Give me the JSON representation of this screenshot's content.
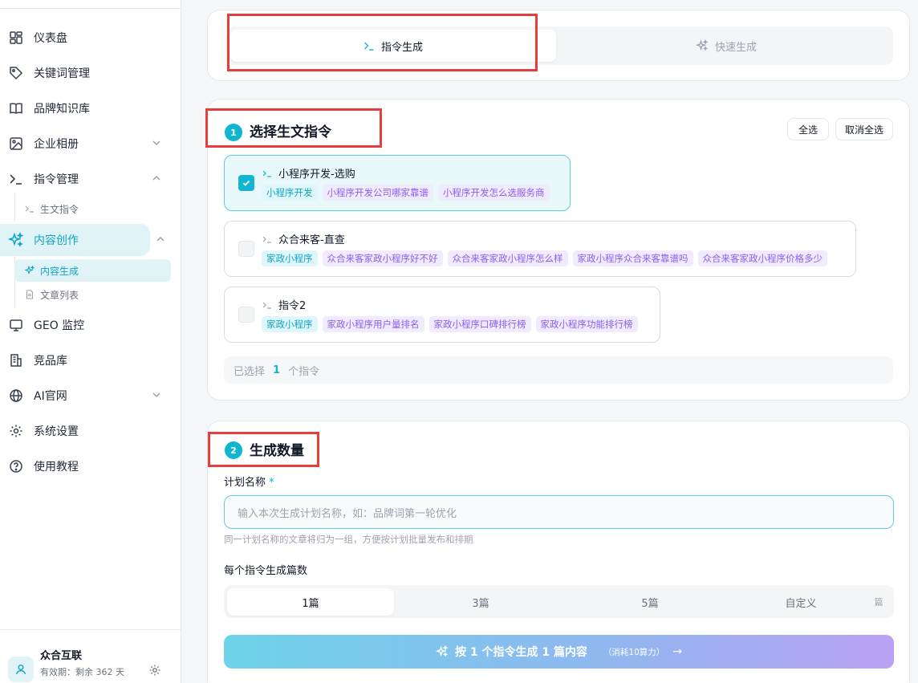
{
  "sidebar": {
    "items": [
      {
        "label": "仪表盘",
        "icon": "dashboard-icon"
      },
      {
        "label": "关键词管理",
        "icon": "tag-icon"
      },
      {
        "label": "品牌知识库",
        "icon": "book-icon"
      },
      {
        "label": "企业相册",
        "icon": "image-icon"
      },
      {
        "label": "指令管理",
        "icon": "terminal-icon"
      },
      {
        "label": "内容创作",
        "icon": "sparkles-icon"
      },
      {
        "label": "GEO 监控",
        "icon": "monitor-icon"
      },
      {
        "label": "竞品库",
        "icon": "building-icon"
      },
      {
        "label": "AI官网",
        "icon": "globe-icon"
      },
      {
        "label": "系统设置",
        "icon": "gear-icon"
      },
      {
        "label": "使用教程",
        "icon": "help-icon"
      }
    ],
    "subitems": {
      "command": {
        "label": "生文指令"
      },
      "content_generate": {
        "label": "内容生成"
      },
      "article_list": {
        "label": "文章列表"
      }
    },
    "user": {
      "name": "众合互联",
      "expiry": "有效期：剩余 362 天"
    }
  },
  "modes": {
    "command": "指令生成",
    "quick": "快速生成"
  },
  "section1": {
    "step": "1",
    "title": "选择生文指令",
    "select_all": "全选",
    "deselect_all": "取消全选",
    "commands": [
      {
        "title": "小程序开发-选购",
        "selected": true,
        "tags": [
          {
            "text": "小程序开发",
            "style": "cyan"
          },
          {
            "text": "小程序开发公司哪家靠谱",
            "style": "purple"
          },
          {
            "text": "小程序开发怎么选服务商",
            "style": "purple"
          }
        ]
      },
      {
        "title": "众合来客-直查",
        "selected": false,
        "tags": [
          {
            "text": "家政小程序",
            "style": "cyan"
          },
          {
            "text": "众合来客家政小程序好不好",
            "style": "purple"
          },
          {
            "text": "众合来客家政小程序怎么样",
            "style": "purple"
          },
          {
            "text": "家政小程序众合来客靠谱吗",
            "style": "purple"
          },
          {
            "text": "众合来客家政小程序价格多少",
            "style": "purple"
          }
        ]
      },
      {
        "title": "指令2",
        "selected": false,
        "tags": [
          {
            "text": "家政小程序",
            "style": "cyan"
          },
          {
            "text": "家政小程序用户量排名",
            "style": "purple"
          },
          {
            "text": "家政小程序口碑排行榜",
            "style": "purple"
          },
          {
            "text": "家政小程序功能排行榜",
            "style": "purple"
          }
        ]
      }
    ],
    "summary": {
      "prefix": "已选择",
      "count": "1",
      "suffix": "个指令"
    }
  },
  "section2": {
    "step": "2",
    "title": "生成数量",
    "plan_label": "计划名称",
    "required_mark": "*",
    "plan_placeholder": "输入本次生成计划名称，如：品牌词第一轮优化",
    "plan_hint": "同一计划名称的文章将归为一组，方便按计划批量发布和排期",
    "count_label": "每个指令生成篇数",
    "count_options": [
      "1篇",
      "3篇",
      "5篇",
      "自定义"
    ],
    "count_selected": "1篇",
    "custom_unit": "篇",
    "generate_label": "按 1 个指令生成 1 篇内容",
    "generate_cost": "（消耗10算力）",
    "generate_arrow": "→"
  },
  "colors": {
    "accent": "#12b5d1",
    "tag_purple": "#8b5cf6",
    "highlight": "#e53e3e"
  }
}
